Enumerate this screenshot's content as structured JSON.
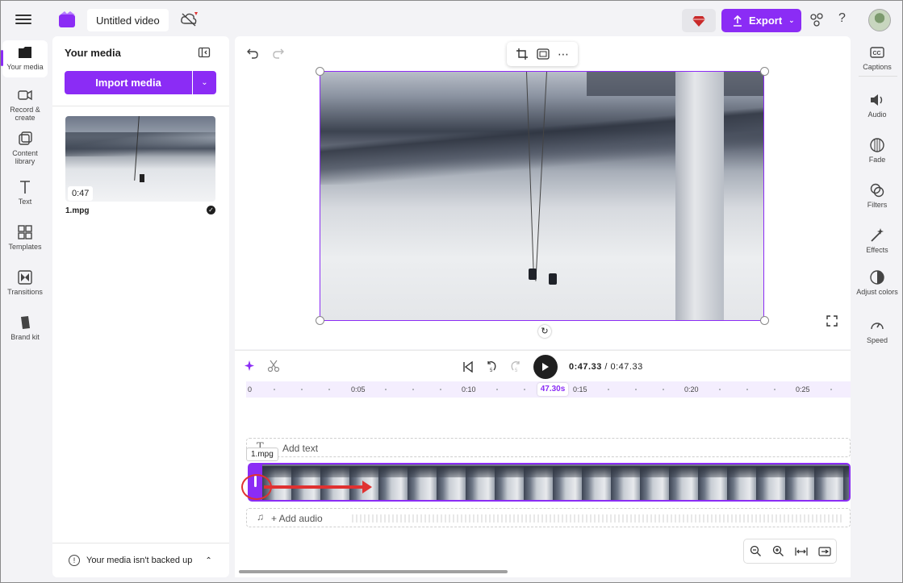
{
  "header": {
    "project_title": "Untitled video",
    "export_label": "Export",
    "help_label": "?"
  },
  "left_rail": {
    "items": [
      {
        "label": "Your media",
        "icon": "media-folder-icon"
      },
      {
        "label": "Record & create",
        "icon": "camera-icon"
      },
      {
        "label": "Content library",
        "icon": "library-icon"
      },
      {
        "label": "Text",
        "icon": "text-icon"
      },
      {
        "label": "Templates",
        "icon": "templates-icon"
      },
      {
        "label": "Transitions",
        "icon": "transitions-icon"
      },
      {
        "label": "Brand kit",
        "icon": "brand-kit-icon"
      }
    ]
  },
  "media_panel": {
    "title": "Your media",
    "import_label": "Import media",
    "clip": {
      "duration": "0:47",
      "name": "1.mpg"
    },
    "backup_note": "Your media isn't backed up"
  },
  "timeline": {
    "current_time": "0:47.33",
    "separator": "/",
    "total_time": "0:47.33",
    "playhead_label": "47.30s",
    "ruler_ticks": [
      "0",
      "0:05",
      "0:10",
      "0:15",
      "0:20",
      "0:25"
    ],
    "add_text_label": "Add text",
    "add_audio_label": "+ Add audio",
    "clip_tag": "1.mpg"
  },
  "right_rail": {
    "items": [
      {
        "label": "Captions",
        "icon": "captions-icon"
      },
      {
        "label": "Audio",
        "icon": "speaker-icon"
      },
      {
        "label": "Fade",
        "icon": "fade-icon"
      },
      {
        "label": "Filters",
        "icon": "filters-icon"
      },
      {
        "label": "Effects",
        "icon": "magic-wand-icon"
      },
      {
        "label": "Adjust colors",
        "icon": "adjust-colors-icon"
      },
      {
        "label": "Speed",
        "icon": "speed-gauge-icon"
      }
    ]
  },
  "colors": {
    "accent": "#8b2cf5",
    "annotation": "#e03131"
  }
}
